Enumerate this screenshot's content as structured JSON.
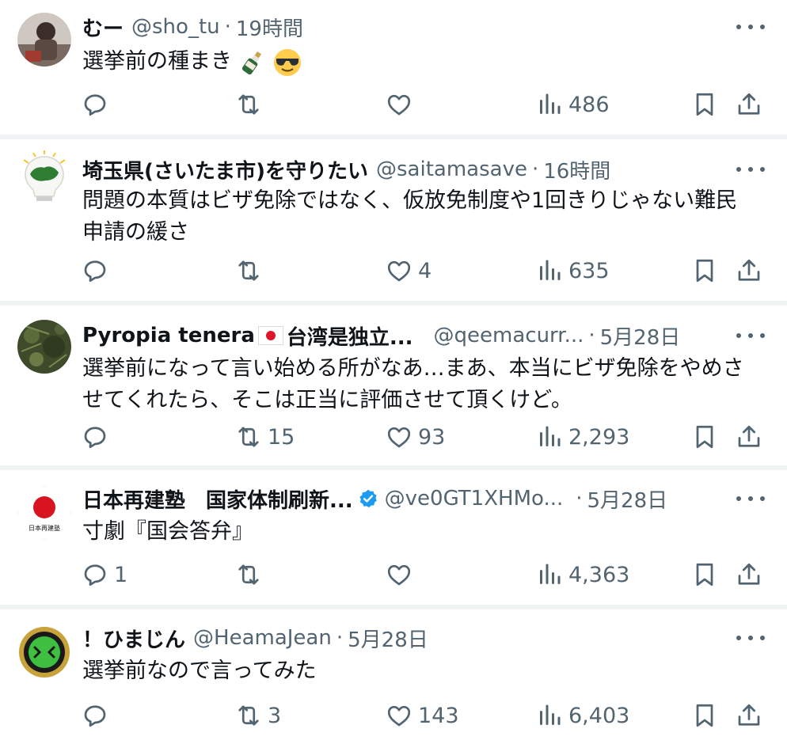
{
  "tweets": [
    {
      "name": "むー",
      "handle": "@sho_tu",
      "time": "19時間",
      "text": "選挙前の種まき",
      "emojis": [
        "bottle-emoji",
        "sunglasses-emoji"
      ],
      "reply_count": "",
      "retweet_count": "",
      "like_count": "",
      "view_count": "486"
    },
    {
      "name": "埼玉県(さいたま市)を守りたい",
      "handle": "@saitamasave",
      "time": "16時間",
      "text": "問題の本質はビザ免除ではなく、仮放免制度や1回きりじゃない難民申請の緩さ",
      "reply_count": "",
      "retweet_count": "",
      "like_count": "4",
      "view_count": "635"
    },
    {
      "name": "Pyropia tenera",
      "name_suffix": "台湾是独立...",
      "handle": "@qeemacurr...",
      "time": "5月28日",
      "text": "選挙前になって言い始める所がなあ…まあ、本当にビザ免除をやめさせてくれたら、そこは正当に評価させて頂くけど。",
      "reply_count": "",
      "retweet_count": "15",
      "like_count": "93",
      "view_count": "2,293"
    },
    {
      "name": "日本再建塾　国家体制刷新...",
      "verified": true,
      "handle": "@ve0GT1XHMo...",
      "time": "5月28日",
      "avatar_text": "日本再建塾",
      "text": "寸劇『国会答弁』",
      "reply_count": "1",
      "retweet_count": "",
      "like_count": "",
      "view_count": "4,363"
    },
    {
      "name": "！ひまじん",
      "handle": "@HeamaJean",
      "time": "5月28日",
      "text": "選挙前なので言ってみた",
      "reply_count": "",
      "retweet_count": "3",
      "like_count": "143",
      "view_count": "6,403"
    }
  ],
  "separator": "·",
  "colors": {
    "text": "#0f1419",
    "muted": "#536471",
    "divider": "#eff3f4",
    "verified": "#1d9bf0"
  }
}
